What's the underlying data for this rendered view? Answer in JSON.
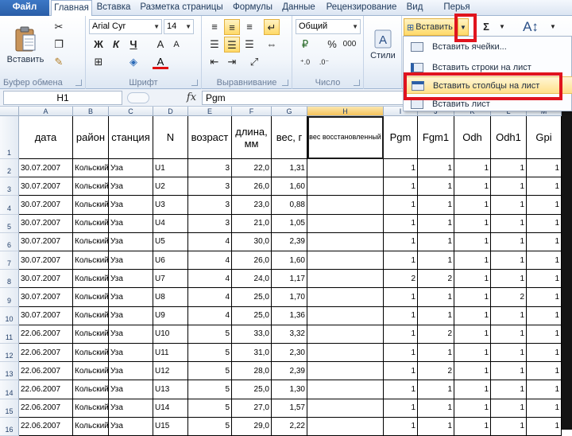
{
  "tabs": [
    "Файл",
    "Главная",
    "Вставка",
    "Разметка страницы",
    "Формулы",
    "Данные",
    "Рецензирование",
    "Вид",
    "Перья"
  ],
  "ribbon": {
    "clipboard": {
      "paste_label": "Вставить",
      "group_label": "Буфер обмена"
    },
    "font": {
      "font_name": "Arial Cyr",
      "font_size": "14",
      "bold": "Ж",
      "italic": "К",
      "underline": "Ч",
      "group_label": "Шрифт"
    },
    "alignment": {
      "group_label": "Выравнивание"
    },
    "number": {
      "format": "Общий",
      "percent": "%",
      "thousands": "000",
      "group_label": "Число"
    },
    "styles": {
      "label": "Стили"
    },
    "cells": {
      "insert_label": "Вставить",
      "sum": "Σ"
    },
    "insert_menu": {
      "items": [
        "Вставить ячейки...",
        "Вставить строки на лист",
        "Вставить столбцы на лист",
        "Вставить лист"
      ]
    }
  },
  "formula_bar": {
    "name_box": "H1",
    "fx": "fx",
    "content": "Pgm"
  },
  "grid": {
    "columns": [
      "A",
      "B",
      "C",
      "D",
      "E",
      "F",
      "G",
      "H",
      "I",
      "J",
      "K",
      "L",
      "M"
    ],
    "selected_column": "H",
    "headers": [
      "дата",
      "район",
      "станция",
      "N",
      "возраст",
      "длина, мм",
      "вес, г",
      "вес восстановленный",
      "Pgm",
      "Fgm1",
      "Odh",
      "Odh1",
      "Gpi"
    ],
    "rows": [
      {
        "n": "2",
        "cells": [
          "30.07.2007",
          "Кольский",
          "Уза",
          "U1",
          "3",
          "22,0",
          "1,31",
          "",
          "1",
          "1",
          "1",
          "1",
          "1"
        ]
      },
      {
        "n": "3",
        "cells": [
          "30.07.2007",
          "Кольский",
          "Уза",
          "U2",
          "3",
          "26,0",
          "1,60",
          "",
          "1",
          "1",
          "1",
          "1",
          "1"
        ]
      },
      {
        "n": "4",
        "cells": [
          "30.07.2007",
          "Кольский",
          "Уза",
          "U3",
          "3",
          "23,0",
          "0,88",
          "",
          "1",
          "1",
          "1",
          "1",
          "1"
        ]
      },
      {
        "n": "5",
        "cells": [
          "30.07.2007",
          "Кольский",
          "Уза",
          "U4",
          "3",
          "21,0",
          "1,05",
          "",
          "1",
          "1",
          "1",
          "1",
          "1"
        ]
      },
      {
        "n": "6",
        "cells": [
          "30.07.2007",
          "Кольский",
          "Уза",
          "U5",
          "4",
          "30,0",
          "2,39",
          "",
          "1",
          "1",
          "1",
          "1",
          "1"
        ]
      },
      {
        "n": "7",
        "cells": [
          "30.07.2007",
          "Кольский",
          "Уза",
          "U6",
          "4",
          "26,0",
          "1,60",
          "",
          "1",
          "1",
          "1",
          "1",
          "1"
        ]
      },
      {
        "n": "8",
        "cells": [
          "30.07.2007",
          "Кольский",
          "Уза",
          "U7",
          "4",
          "24,0",
          "1,17",
          "",
          "2",
          "2",
          "1",
          "1",
          "1"
        ]
      },
      {
        "n": "9",
        "cells": [
          "30.07.2007",
          "Кольский",
          "Уза",
          "U8",
          "4",
          "25,0",
          "1,70",
          "",
          "1",
          "1",
          "1",
          "2",
          "1"
        ]
      },
      {
        "n": "10",
        "cells": [
          "30.07.2007",
          "Кольский",
          "Уза",
          "U9",
          "4",
          "25,0",
          "1,36",
          "",
          "1",
          "1",
          "1",
          "1",
          "1"
        ]
      },
      {
        "n": "11",
        "cells": [
          "22.06.2007",
          "Кольский",
          "Уза",
          "U10",
          "5",
          "33,0",
          "3,32",
          "",
          "1",
          "2",
          "1",
          "1",
          "1"
        ]
      },
      {
        "n": "12",
        "cells": [
          "22.06.2007",
          "Кольский",
          "Уза",
          "U11",
          "5",
          "31,0",
          "2,30",
          "",
          "1",
          "1",
          "1",
          "1",
          "1"
        ]
      },
      {
        "n": "13",
        "cells": [
          "22.06.2007",
          "Кольский",
          "Уза",
          "U12",
          "5",
          "28,0",
          "2,39",
          "",
          "1",
          "2",
          "1",
          "1",
          "1"
        ]
      },
      {
        "n": "14",
        "cells": [
          "22.06.2007",
          "Кольский",
          "Уза",
          "U13",
          "5",
          "25,0",
          "1,30",
          "",
          "1",
          "1",
          "1",
          "1",
          "1"
        ]
      },
      {
        "n": "15",
        "cells": [
          "22.06.2007",
          "Кольский",
          "Уза",
          "U14",
          "5",
          "27,0",
          "1,57",
          "",
          "1",
          "1",
          "1",
          "1",
          "1"
        ]
      },
      {
        "n": "16",
        "cells": [
          "22.06.2007",
          "Кольский",
          "Уза",
          "U15",
          "5",
          "29,0",
          "2,22",
          "",
          "1",
          "1",
          "1",
          "1",
          "1"
        ]
      }
    ]
  }
}
